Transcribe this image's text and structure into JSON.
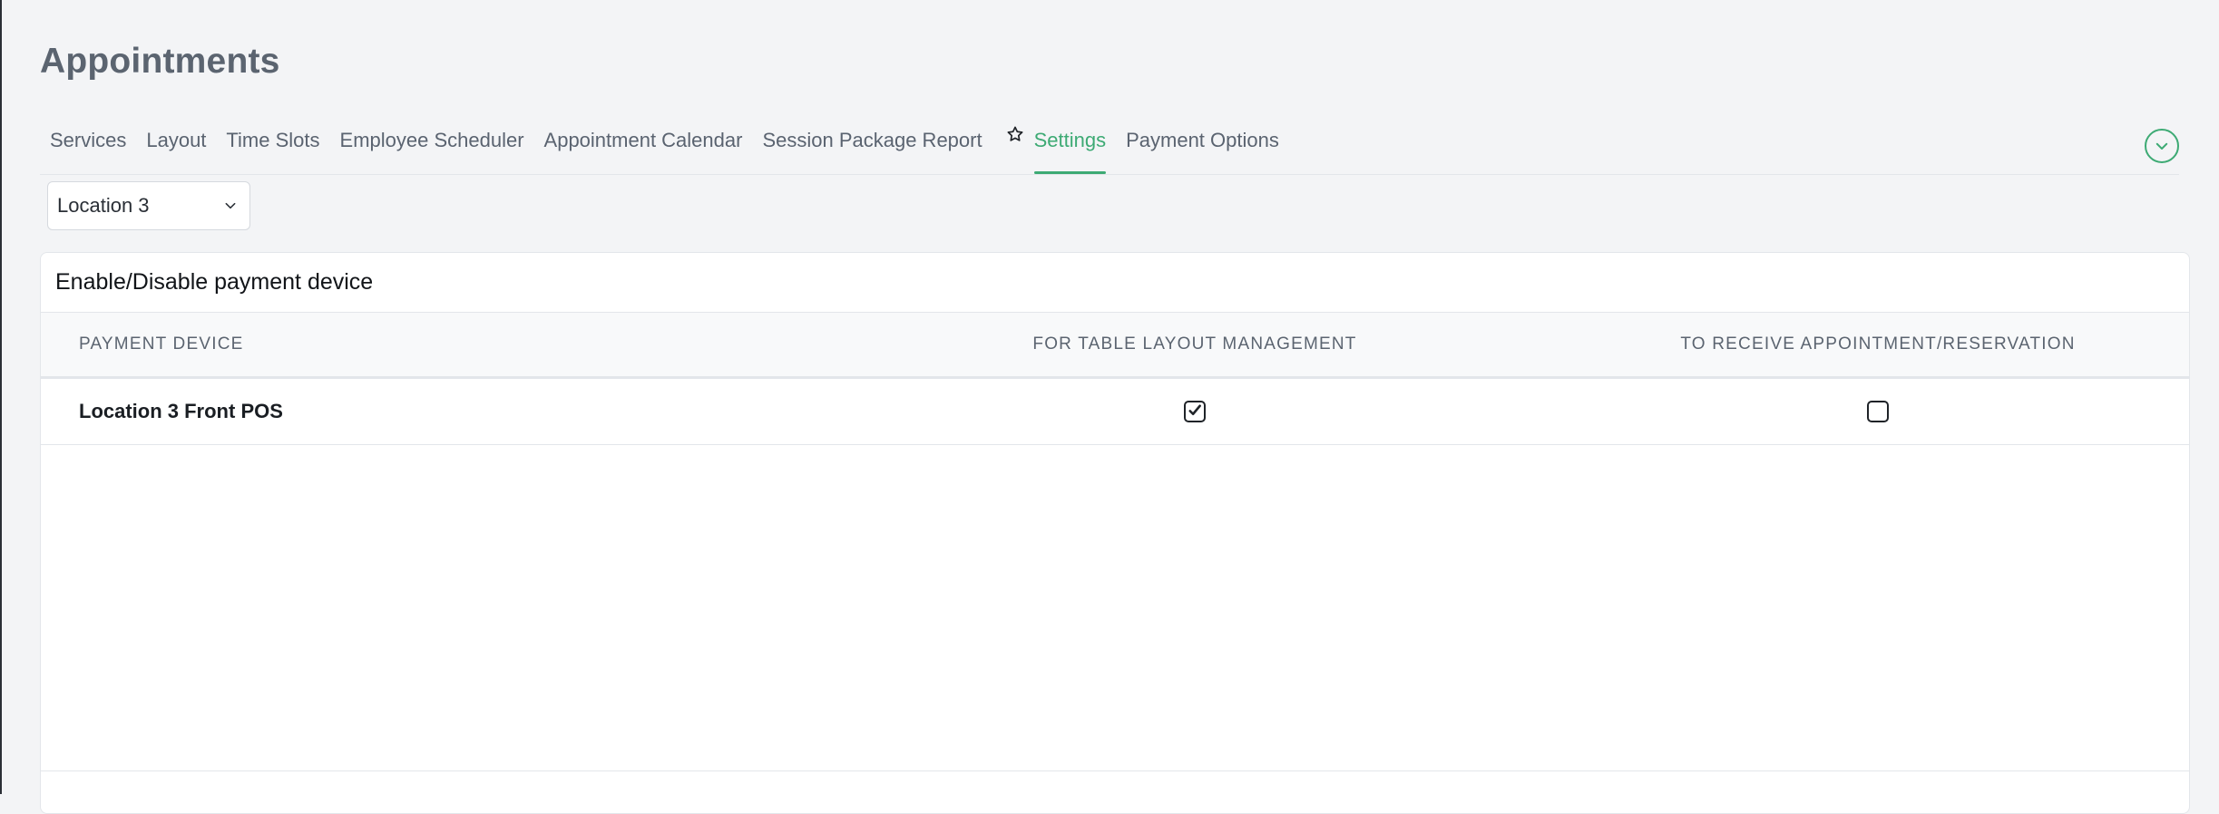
{
  "page": {
    "title": "Appointments"
  },
  "tabs": [
    {
      "label": "Services",
      "active": false
    },
    {
      "label": "Layout",
      "active": false
    },
    {
      "label": "Time Slots",
      "active": false
    },
    {
      "label": "Employee Scheduler",
      "active": false
    },
    {
      "label": "Appointment Calendar",
      "active": false
    },
    {
      "label": "Session Package Report",
      "active": false
    },
    {
      "label": "Settings",
      "active": true,
      "icon": "star-icon"
    },
    {
      "label": "Payment Options",
      "active": false
    }
  ],
  "location_select": {
    "value": "Location 3"
  },
  "card": {
    "title": "Enable/Disable payment device",
    "columns": {
      "device": "PAYMENT DEVICE",
      "layout": "FOR TABLE LAYOUT MANAGEMENT",
      "appointment": "TO RECEIVE APPOINTMENT/RESERVATION"
    },
    "rows": [
      {
        "device": "Location 3 Front POS",
        "table_layout": true,
        "appointment": false
      }
    ]
  },
  "colors": {
    "accent": "#3daa74",
    "background": "#f3f4f6",
    "title": "#5b6470"
  },
  "icons": {
    "collapse": "chevron-down-circle-icon",
    "select": "chevron-down-icon",
    "settings_tab": "star-icon"
  }
}
